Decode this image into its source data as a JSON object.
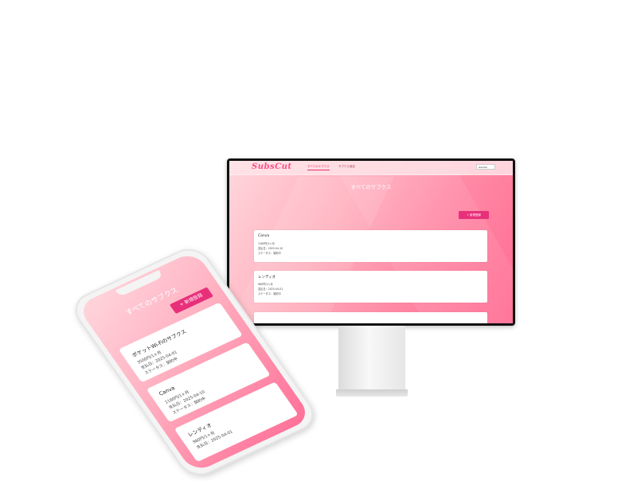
{
  "app": {
    "logo": "SubsCut"
  },
  "nav": {
    "tab_all": "すべてのサブクス",
    "tab_second": "サブクス追加"
  },
  "lang_select": {
    "value": "Gender"
  },
  "page": {
    "title": "すべてのサブクス",
    "add_button": "+ 新規登録"
  },
  "desktop_cards": [
    {
      "name": "Canva",
      "price": "1180円/1ヶ月",
      "paydate": "支払日：2025-04-10",
      "status": "ステータス：契約中"
    },
    {
      "name": "レンディオ",
      "price": "980円/1ヶ月",
      "paydate": "支払日：2025-04-01",
      "status": "ステータス：契約中"
    }
  ],
  "phone_cards": [
    {
      "name": "ポケットWi-Fiのサブクス",
      "price": "3500円/1ヶ月",
      "paydate": "支払日：2025-04-01",
      "status": "ステータス：契約中"
    },
    {
      "name": "Canva",
      "price": "1180円/1ヶ月",
      "paydate": "支払日：2025-04-10",
      "status": "ステータス：契約中"
    },
    {
      "name": "レンディオ",
      "price": "980円/1ヶ月",
      "paydate": "支払日：2025-04-01"
    }
  ],
  "colors": {
    "accent": "#e8307a",
    "gradient_start": "#ffd6dc",
    "gradient_end": "#ff6b92"
  }
}
